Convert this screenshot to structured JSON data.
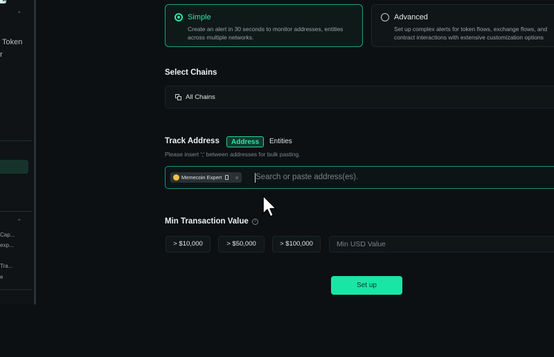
{
  "sidebar": {
    "badge": "w",
    "item_token": "Token",
    "item_r": "r",
    "list": [
      "Cap...",
      "exp...",
      "Tra...",
      "e"
    ]
  },
  "modes": [
    {
      "title": "Simple",
      "description_lines": [
        "Create an alert in 30 seconds to monitor addresses, entities",
        "across multiple networks."
      ],
      "selected": true
    },
    {
      "title": "Advanced",
      "description_lines": [
        "Set up complex alerts for token flows, exchange flows, and",
        "contract interactions with extensive customization options"
      ],
      "selected": false
    }
  ],
  "chains": {
    "label": "Select Chains",
    "selected": "All Chains",
    "icon": "chains-icon"
  },
  "track": {
    "label": "Track Address",
    "tabs": [
      "Address",
      "Entities"
    ],
    "active_tab": "Address",
    "hint": "Please insert ';' between addresses for bulk pasting.",
    "chip_label": "Memecoin Expert",
    "placeholder": "Search or paste address(es)."
  },
  "min_value": {
    "label": "Min Transaction Value",
    "options": [
      "> $10,000",
      "> $50,000",
      "> $100,000"
    ],
    "placeholder": "Min USD Value"
  },
  "setup_label": "Set up",
  "colors": {
    "accent": "#2ee6a6",
    "button": "#19e6a5",
    "background": "#0c1013"
  }
}
